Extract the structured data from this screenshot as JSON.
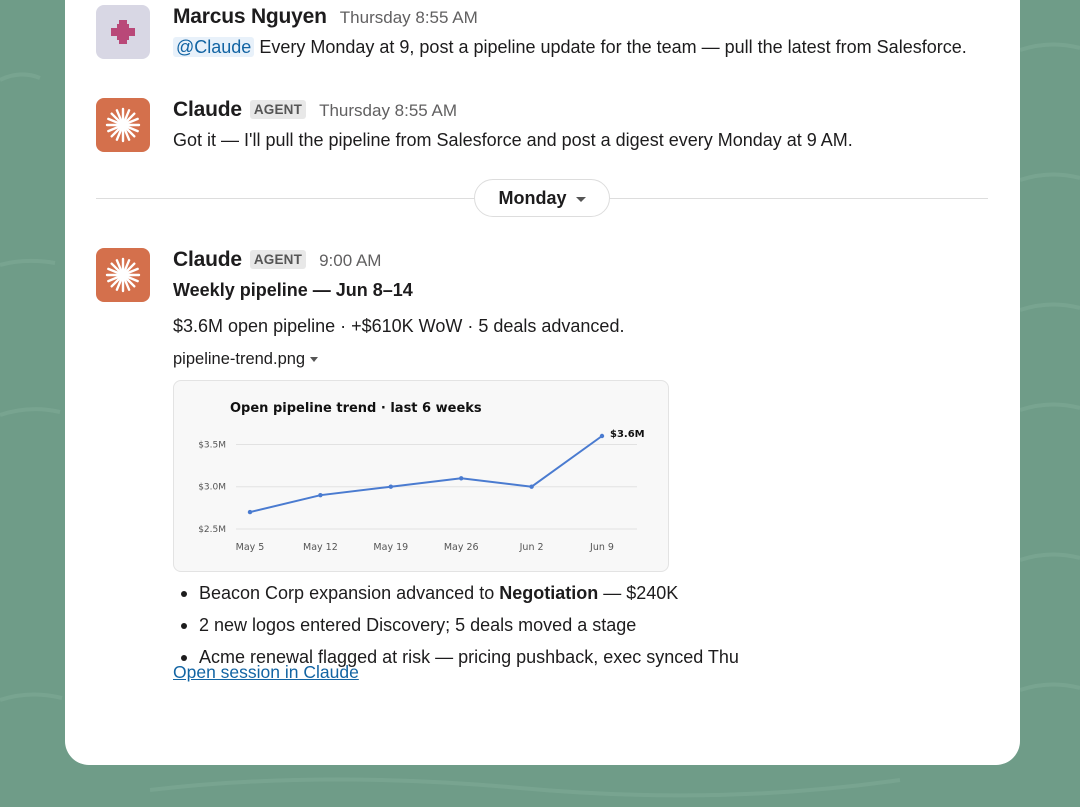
{
  "messages": [
    {
      "author": "Marcus Nguyen",
      "time": "Thursday 8:55 AM",
      "mention": "@Claude",
      "text": "Every Monday at 9, post a pipeline update for the team — pull the latest from Salesforce."
    },
    {
      "author": "Claude",
      "badge": "AGENT",
      "time": "Thursday 8:55 AM",
      "text": "Got it — I'll pull the pipeline from Salesforce and post a digest every Monday at 9 AM."
    },
    {
      "author": "Claude",
      "badge": "AGENT",
      "time": "9:00 AM",
      "title": "Weekly pipeline — Jun 8–14",
      "summary": "$3.6M open pipeline · +$610K WoW · 5 deals advanced.",
      "file_name": "pipeline-trend.png",
      "bullets": [
        {
          "pre": "Beacon Corp expansion advanced to ",
          "bold": "Negotiation",
          "post": " — $240K"
        },
        {
          "pre": "2 new logos entered Discovery; 5 deals moved a stage",
          "bold": "",
          "post": ""
        },
        {
          "pre": "Acme renewal flagged at risk — pricing pushback, exec synced Thu",
          "bold": "",
          "post": ""
        }
      ],
      "link": "Open session in Claude"
    }
  ],
  "day_divider": "Monday",
  "chart_data": {
    "type": "line",
    "title": "Open pipeline trend · last 6 weeks",
    "categories": [
      "May 5",
      "May 12",
      "May 19",
      "May 26",
      "Jun 2",
      "Jun 9"
    ],
    "values": [
      2.7,
      2.9,
      3.0,
      3.1,
      3.0,
      3.6
    ],
    "unit_prefix": "$",
    "unit_suffix": "M",
    "yticks": [
      "$2.5M",
      "$3.0M",
      "$3.5M"
    ],
    "ytick_values": [
      2.5,
      3.0,
      3.5
    ],
    "ylim": [
      2.5,
      3.6
    ],
    "end_label": "$3.6M",
    "grid": true,
    "line_color": "#4a7bd0"
  },
  "colors": {
    "background": "#6f9c88",
    "link": "#1264a3",
    "claude_avatar": "#d4704c",
    "user_avatar_bg": "#d8d7e4",
    "user_avatar_fg": "#b94878"
  },
  "icons": {
    "user_avatar": "pixel-cross-icon",
    "claude_avatar": "claude-sunburst-icon"
  }
}
